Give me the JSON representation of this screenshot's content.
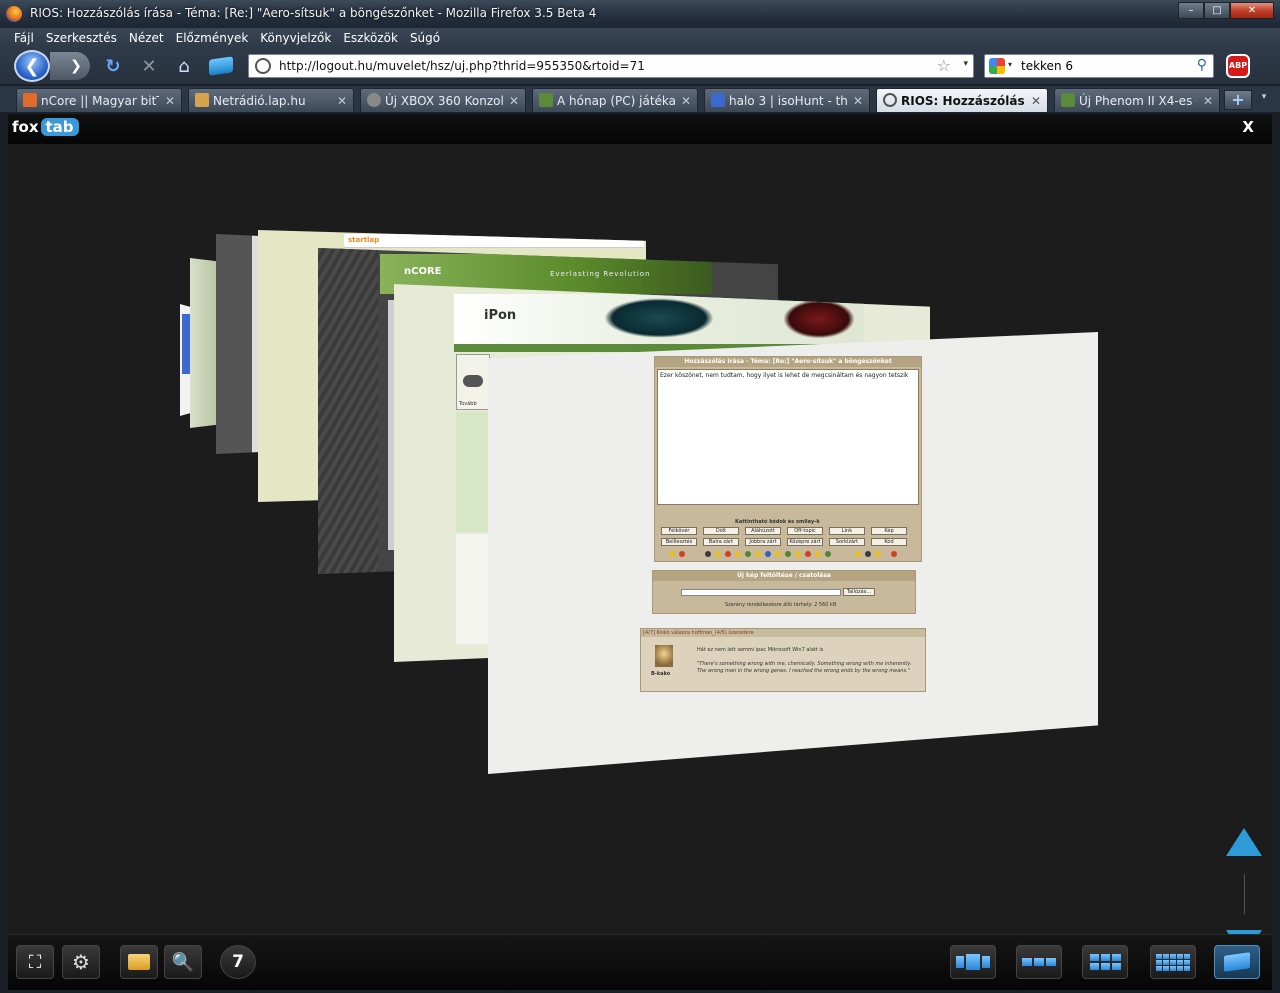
{
  "window": {
    "title": "RIOS: Hozzászólás írása - Téma: [Re:] \"Aero-sítsuk\" a böngészőnket - Mozilla Firefox 3.5 Beta 4",
    "controls": {
      "minimize": "–",
      "maximize": "□",
      "close": "✕"
    }
  },
  "menu": [
    "Fájl",
    "Szerkesztés",
    "Nézet",
    "Előzmények",
    "Könyvjelzők",
    "Eszközök",
    "Súgó"
  ],
  "nav": {
    "back": "❮",
    "forward": "❯",
    "reload": "↻",
    "stop": "✕",
    "home": "⌂",
    "url": "http://logout.hu/muvelet/hsz/uj.php?thrid=955350&rtoid=71",
    "star": "☆",
    "dropdown": "▾"
  },
  "search": {
    "value": "tekken 6",
    "icon": "⚲"
  },
  "abp": "ABP",
  "tabs": [
    {
      "label": "nCore || Magyar bitT...",
      "close": "✕",
      "icon_color": "#e06b2a"
    },
    {
      "label": "Netrádió.lap.hu",
      "close": "✕",
      "icon_color": "#d6a44a"
    },
    {
      "label": "Új XBOX 360 Konzolo...",
      "close": "✕",
      "icon_color": "#888888"
    },
    {
      "label": "A hónap (PC) játéka ...",
      "close": "✕",
      "icon_color": "#5a8a3a"
    },
    {
      "label": "halo 3 | isoHunt - the...",
      "close": "✕",
      "icon_color": "#3a6ad0"
    },
    {
      "label": "RIOS: Hozzászólás ír...",
      "close": "✕",
      "icon_color": "#555555"
    },
    {
      "label": "Új Phenom II X4-es C...",
      "close": "✕",
      "icon_color": "#5a8a3a"
    }
  ],
  "newtab": "+",
  "tablist": "▾",
  "foxtab": {
    "logo_fox": "fox",
    "logo_tab": "tab",
    "close": "X",
    "thumb_texts": {
      "ncore_logo": "nCORE",
      "ncore_slogan": "Everlasting Revolution",
      "startlap": "startlap",
      "ipon_logo": "iPon",
      "form_title": "Hozzászólás írása · Téma: [Re:] \"Aero-sítsuk\" a böngészőnket",
      "textarea_text": "Ezer köszönet, nem tudtam, hogy ilyet is lehet de megcsináltam és nagyon tetszik",
      "allowed_tags": "Kattintható kódok és smiley-k",
      "buttons": [
        "Félkövér",
        "Dőlt",
        "Aláhúzott",
        "Off-topic",
        "Link",
        "Kép",
        "Beillesztés",
        "Balra zárt",
        "Jobbra zárt",
        "Középre zárt",
        "Sorkizárt",
        "Kód"
      ],
      "upload_title": "Új kép feltöltése / csatolása",
      "upload_btn": "Tallózás...",
      "quota": "Szerény rendelkezésre álló tárhely: 2 560 kB",
      "post_user": "[4/7] Kiskó válasza hoffman_(4/5) üzenetére",
      "post_text": "Hát ez nem lett semmi ipac   Mikrosoft Win7 alatt is",
      "post_quote": "\"There's something wrong with me, chemically. Something wrong with me inherently. The wrong man in the wrong genes. I reached the wrong ends by the wrong means.\"",
      "post_nick": "B-kako",
      "sidebar_more": "Tovább"
    },
    "bottom": {
      "fullscreen": "⛶",
      "settings": "⚙",
      "search": "🔍",
      "count": "7"
    },
    "accent_color": "#2e9bd6"
  }
}
